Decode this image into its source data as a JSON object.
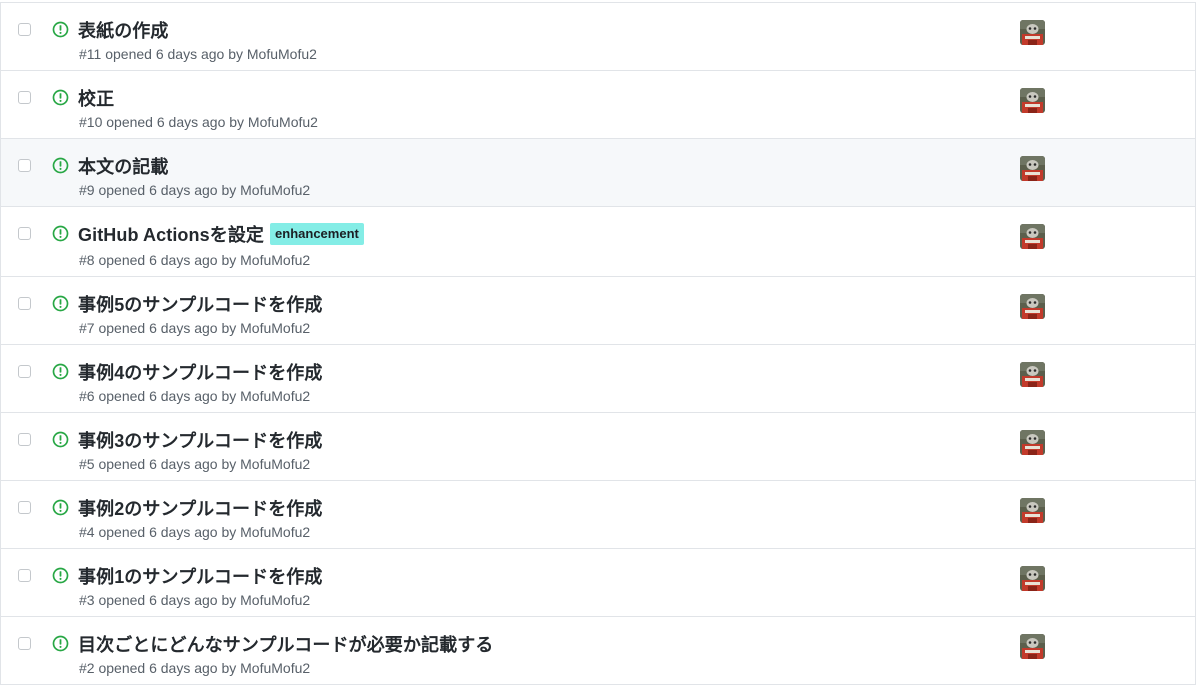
{
  "issues": [
    {
      "title": "表紙の作成",
      "meta": "#11 opened 6 days ago by ",
      "author": "MofuMofu2",
      "label": ""
    },
    {
      "title": "校正",
      "meta": "#10 opened 6 days ago by ",
      "author": "MofuMofu2",
      "label": ""
    },
    {
      "title": "本文の記載",
      "meta": "#9 opened 6 days ago by ",
      "author": "MofuMofu2",
      "label": ""
    },
    {
      "title": "GitHub Actionsを設定",
      "meta": "#8 opened 6 days ago by ",
      "author": "MofuMofu2",
      "label": "enhancement"
    },
    {
      "title": "事例5のサンプルコードを作成",
      "meta": "#7 opened 6 days ago by ",
      "author": "MofuMofu2",
      "label": ""
    },
    {
      "title": "事例4のサンプルコードを作成",
      "meta": "#6 opened 6 days ago by ",
      "author": "MofuMofu2",
      "label": ""
    },
    {
      "title": "事例3のサンプルコードを作成",
      "meta": "#5 opened 6 days ago by ",
      "author": "MofuMofu2",
      "label": ""
    },
    {
      "title": "事例2のサンプルコードを作成",
      "meta": "#4 opened 6 days ago by ",
      "author": "MofuMofu2",
      "label": ""
    },
    {
      "title": "事例1のサンプルコードを作成",
      "meta": "#3 opened 6 days ago by ",
      "author": "MofuMofu2",
      "label": ""
    },
    {
      "title": "目次ごとにどんなサンプルコードが必要か記載する",
      "meta": "#2 opened 6 days ago by ",
      "author": "MofuMofu2",
      "label": ""
    }
  ],
  "colors": {
    "open_icon": "#28a745",
    "label_enhancement": "#84ede6",
    "row_hover": "#f6f8fa",
    "border": "#e1e4e8",
    "meta_text": "#586069"
  },
  "icons": {
    "status": "issue-opened-icon",
    "avatar": "user-avatar"
  }
}
